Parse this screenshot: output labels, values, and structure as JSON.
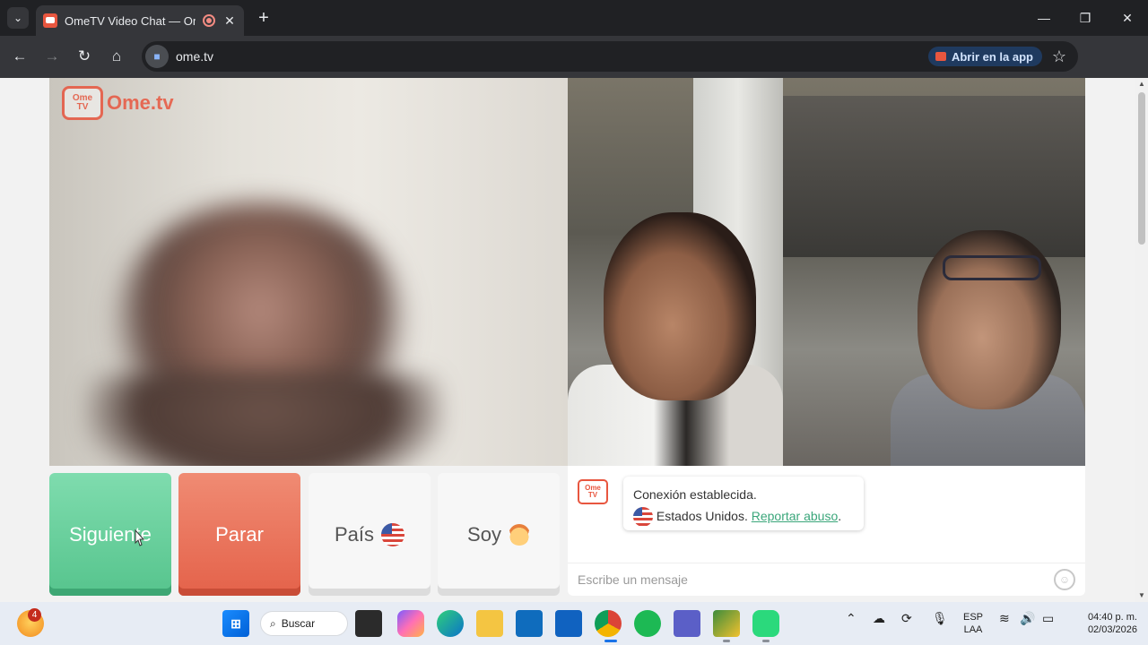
{
  "browser": {
    "tab_title": "OmeTV Video Chat — Ome",
    "new_tab": "+",
    "url": "ome.tv",
    "open_in_app": "Abrir en la app",
    "icons": {
      "tab_search": "chevron-down-icon",
      "recording": "record-icon",
      "back": "arrow-left-icon",
      "forward": "arrow-right-icon",
      "reload": "reload-icon",
      "home": "home-icon",
      "bookmark": "star-icon",
      "menu": "more-vert-icon"
    }
  },
  "page": {
    "brand_logo_line1": "Ome",
    "brand_logo_line2": "TV",
    "brand_name": "Ome.tv",
    "buttons": {
      "next": "Siguiente",
      "stop": "Parar",
      "country": "País",
      "gender": "Soy"
    },
    "chat": {
      "logo_line1": "Ome",
      "logo_line2": "TV",
      "connection": "Conexión establecida.",
      "country": "Estados Unidos.",
      "report": "Reportar abuso",
      "period": ".",
      "placeholder": "Escribe un mensaje"
    },
    "colors": {
      "next": "#56c48d",
      "stop": "#e4624a",
      "brand": "#e8563f",
      "link": "#3aa67a"
    }
  },
  "taskbar": {
    "widgets_badge": "4",
    "search": "Buscar",
    "lang_line1": "ESP",
    "lang_line2": "LAA",
    "time": "04:40 p. m.",
    "date": "02/03/2026"
  }
}
